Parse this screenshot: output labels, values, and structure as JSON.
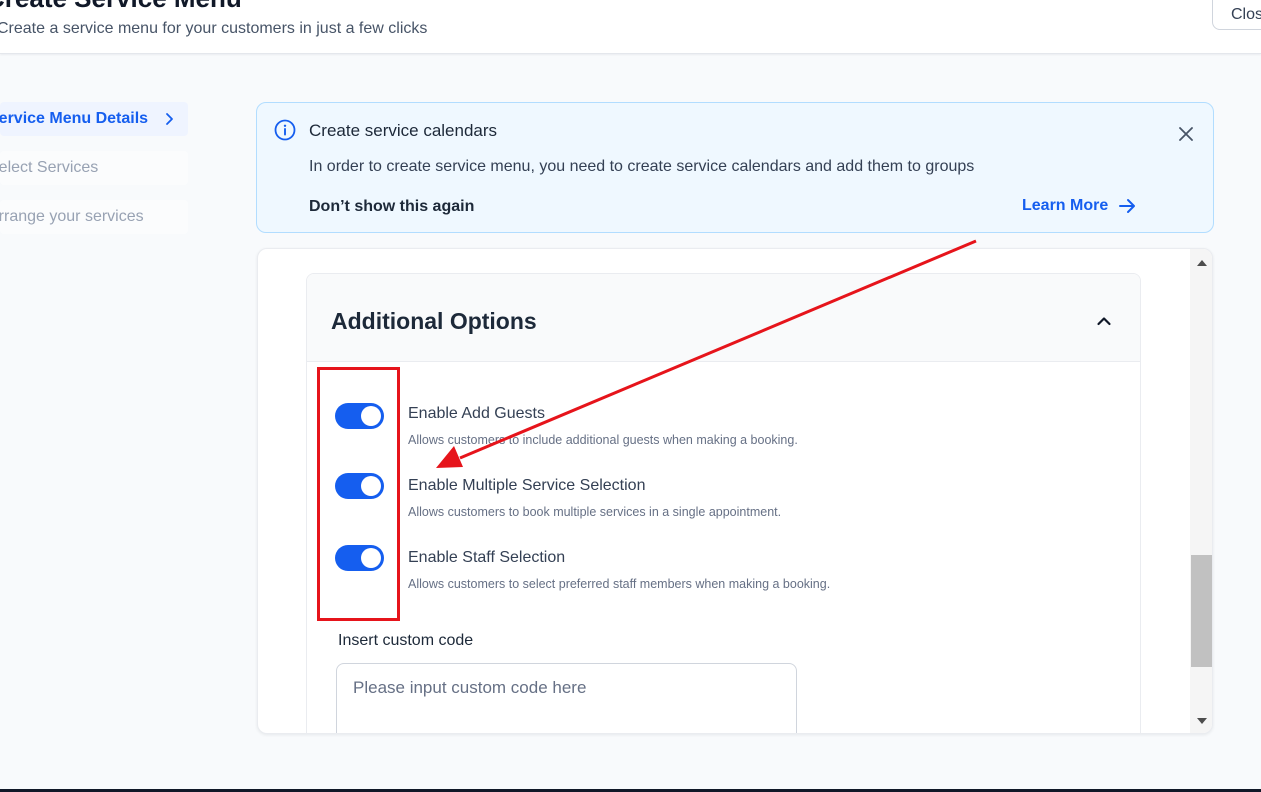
{
  "header": {
    "title": "Create Service Menu",
    "subtitle": "Create a service menu for your customers in just a few clicks",
    "close_label": "Close"
  },
  "steps": [
    {
      "label": "Service Menu Details",
      "active": true
    },
    {
      "label": "Select Services",
      "active": false
    },
    {
      "label": "Arrange your services",
      "active": false
    }
  ],
  "banner": {
    "title": "Create service calendars",
    "text": "In order to create service menu, you need to create service calendars and add them to groups",
    "dismiss_label": "Don’t show this again",
    "learn_more_label": "Learn More"
  },
  "additional_options": {
    "title": "Additional Options",
    "options": [
      {
        "label": "Enable Add Guests",
        "description": "Allows customers to include additional guests when making a booking.",
        "enabled": true
      },
      {
        "label": "Enable Multiple Service Selection",
        "description": "Allows customers to book multiple services in a single appointment.",
        "enabled": true
      },
      {
        "label": "Enable Staff Selection",
        "description": "Allows customers to select preferred staff members when making a booking.",
        "enabled": true
      }
    ],
    "custom_code_label": "Insert custom code",
    "custom_code_placeholder": "Please input custom code here",
    "custom_code_value": ""
  },
  "colors": {
    "primary": "#155eef",
    "banner_bg": "#eff8ff",
    "annotation_red": "#e6141b"
  },
  "icons": {
    "banner": "info-icon",
    "learn_more": "arrow-right-icon",
    "banner_close": "close-icon",
    "step_active": "chevron-right-icon",
    "section_toggle": "chevron-up-icon"
  }
}
